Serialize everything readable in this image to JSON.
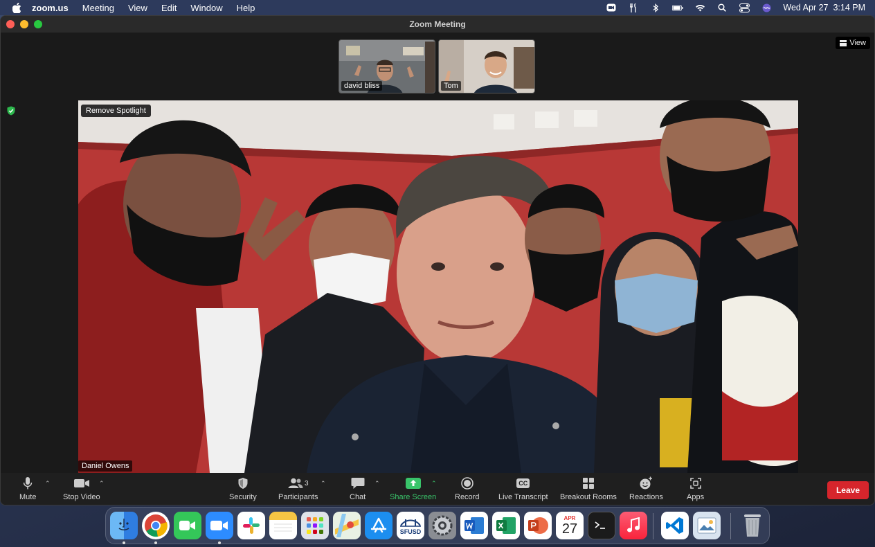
{
  "menubar": {
    "app_name": "zoom.us",
    "items": [
      "Meeting",
      "View",
      "Edit",
      "Window",
      "Help"
    ],
    "clock": "Wed Apr 27  3:14 PM"
  },
  "window": {
    "title": "Zoom Meeting",
    "view_label": "View",
    "remove_spotlight_label": "Remove Spotlight",
    "speaker_name": "Daniel Owens"
  },
  "thumbnails": [
    {
      "name": "david bliss"
    },
    {
      "name": "Tom"
    }
  ],
  "toolbar": {
    "mute": "Mute",
    "stop_video": "Stop Video",
    "security": "Security",
    "participants": "Participants",
    "participants_count": "3",
    "chat": "Chat",
    "share_screen": "Share Screen",
    "record": "Record",
    "live_transcript": "Live Transcript",
    "breakout_rooms": "Breakout Rooms",
    "reactions": "Reactions",
    "apps": "Apps",
    "leave": "Leave",
    "cc_label": "CC"
  },
  "dock": {
    "calendar_month": "APR",
    "calendar_day": "27",
    "sfusd_label": "SFUSD"
  },
  "colors": {
    "leave": "#d6252c",
    "share": "#39c46a",
    "accent_blue": "#2d8cff"
  }
}
